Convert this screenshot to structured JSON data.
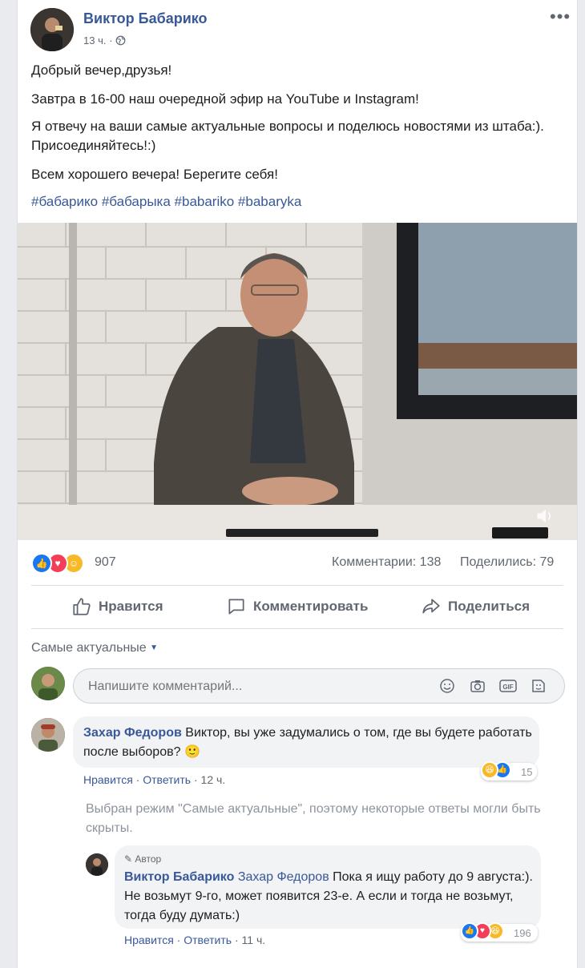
{
  "post": {
    "author": "Виктор Бабарико",
    "time": "13 ч.",
    "paragraphs": [
      "Добрый вечер,друзья!",
      "Завтра в 16-00 наш очередной эфир на YouTube и Instagram!",
      "Я отвечу на ваши самые актуальные вопросы и поделюсь новостями из штаба:). Присоединяйтесь!:)",
      "Всем хорошего вечера! Берегите себя!"
    ],
    "hashtags": "#бабарико #бабарыка #babariko #babaryka"
  },
  "stats": {
    "reactions_count": "907",
    "comments": "Комментарии: 138",
    "shares": "Поделились: 79"
  },
  "actions": {
    "like": "Нравится",
    "comment": "Комментировать",
    "share": "Поделиться"
  },
  "comments_section": {
    "sort_label": "Самые актуальные",
    "input_placeholder": "Напишите комментарий...",
    "hint": "Выбран режим \"Самые актуальные\", поэтому некоторые ответы могли быть скрыты."
  },
  "comment1": {
    "author": "Захар Федоров",
    "text": "Виктор, вы уже задумались о том, где вы будете работать после выборов? 🙂",
    "like": "Нравится",
    "reply": "Ответить",
    "time": "12 ч.",
    "reactions_count": "15"
  },
  "reply1": {
    "badge": "Автор",
    "author": "Виктор Бабарико",
    "mention": "Захар Федоров",
    "text": "Пока я ищу работу до 9 августа:). Не возьмут 9-го, может появится 23-е. А если и тогда не возьмут, тогда буду думать:)",
    "like": "Нравится",
    "reply": "Ответить",
    "time": "11 ч.",
    "reactions_count": "196"
  },
  "colors": {
    "link": "#385898",
    "like_blue": "#1877f2",
    "love_red": "#f33e58",
    "haha_yellow": "#f7b928"
  }
}
